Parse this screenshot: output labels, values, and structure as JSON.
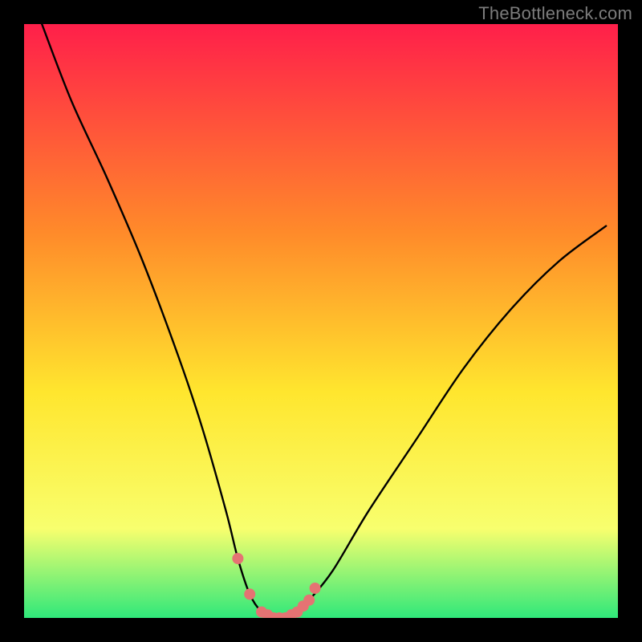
{
  "watermark": "TheBottleneck.com",
  "colors": {
    "background": "#000000",
    "gradient_top": "#ff1f4a",
    "gradient_mid1": "#ff8a2a",
    "gradient_mid2": "#ffe62e",
    "gradient_mid3": "#f8ff6e",
    "gradient_bottom": "#2fe87a",
    "curve": "#000000",
    "markers": "#e57373"
  },
  "chart_data": {
    "type": "line",
    "title": "",
    "xlabel": "",
    "ylabel": "",
    "xlim": [
      0,
      100
    ],
    "ylim": [
      0,
      100
    ],
    "series": [
      {
        "name": "bottleneck-curve",
        "x": [
          3,
          8,
          14,
          20,
          26,
          30,
          34,
          36,
          38,
          40,
          42,
          44,
          46,
          48,
          52,
          58,
          66,
          74,
          82,
          90,
          98
        ],
        "y": [
          100,
          87,
          74,
          60,
          44,
          32,
          18,
          10,
          4,
          1,
          0,
          0,
          1,
          3,
          8,
          18,
          30,
          42,
          52,
          60,
          66
        ]
      }
    ],
    "markers": {
      "name": "sweet-spot",
      "x": [
        36,
        38,
        40,
        41,
        42,
        43,
        44,
        45,
        46,
        47,
        48,
        49
      ],
      "y": [
        10,
        4,
        1,
        0.5,
        0,
        0,
        0,
        0.5,
        1,
        2,
        3,
        5
      ]
    }
  }
}
